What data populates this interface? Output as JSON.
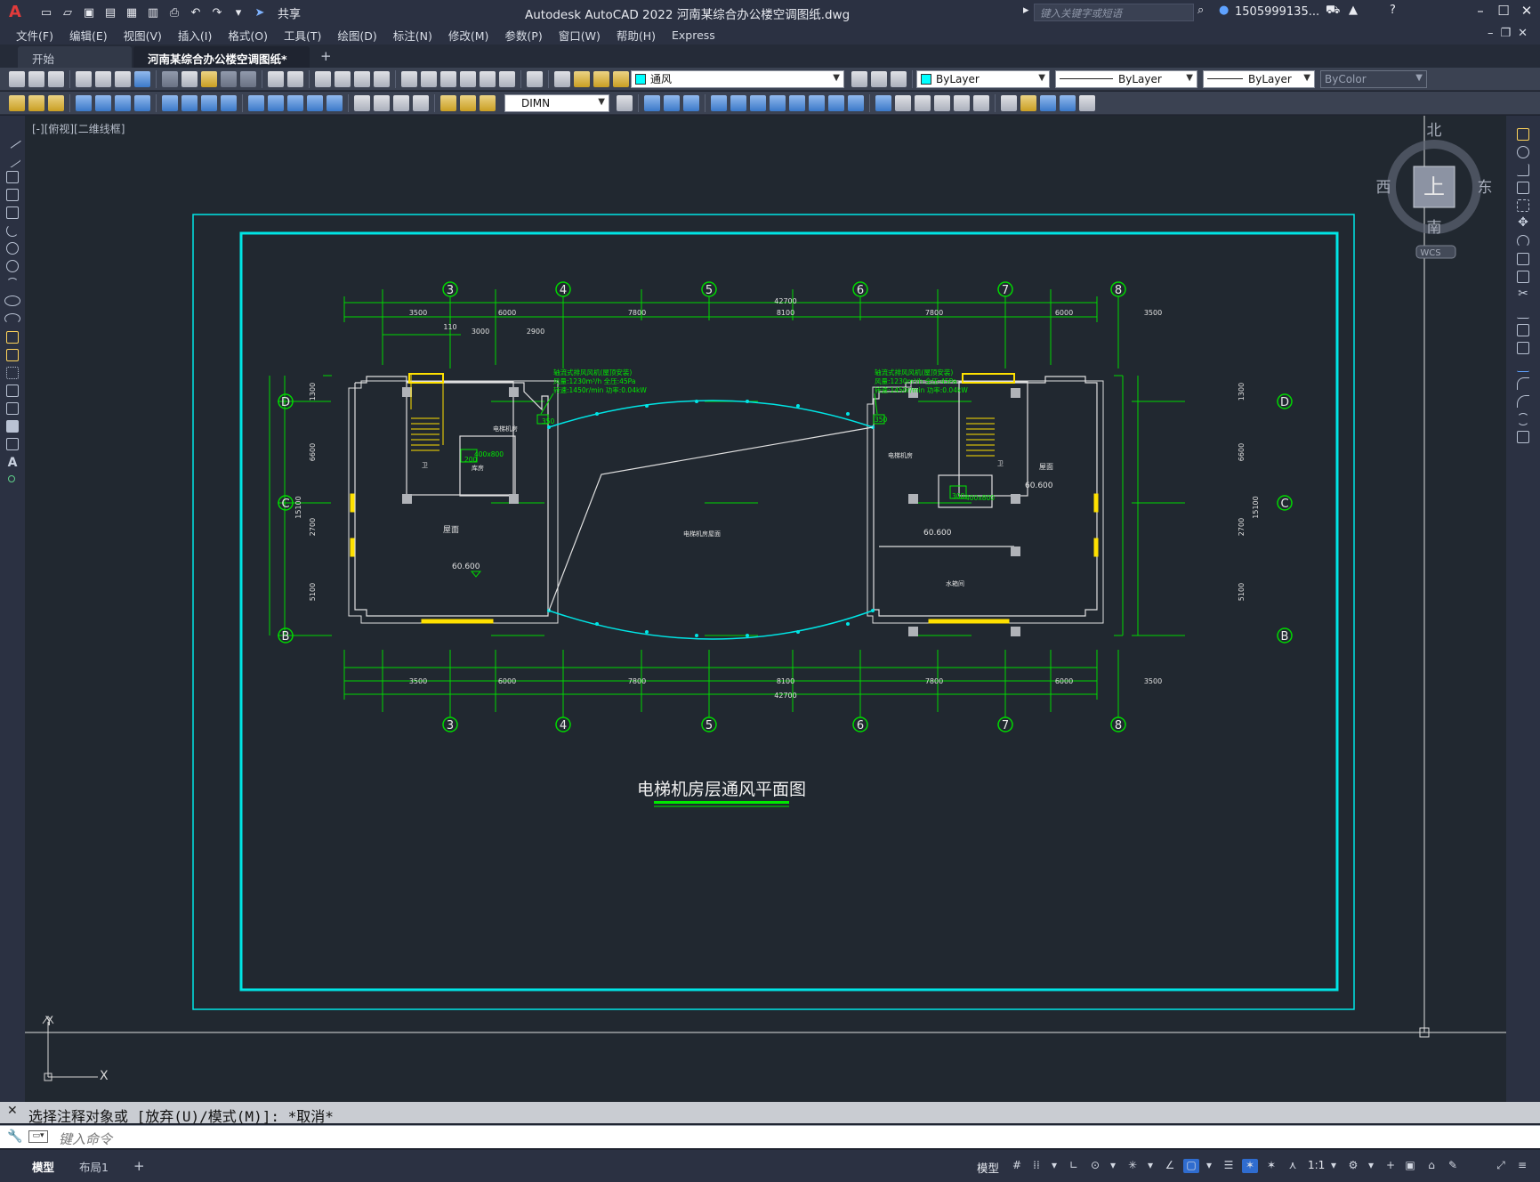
{
  "titlebar": {
    "share_label": "共享",
    "window_title": "Autodesk AutoCAD 2022    河南某综合办公楼空调图纸.dwg",
    "search_placeholder": "键入关键字或短语",
    "user": "1505999135...",
    "icons": [
      "autocad-logo-icon",
      "new-icon",
      "open-icon",
      "save-icon",
      "saveas-icon",
      "web-open-icon",
      "plot-icon",
      "undo-icon",
      "redo-icon",
      "share-icon",
      "search-icon",
      "user-icon",
      "cart-icon",
      "a360-icon",
      "help-icon",
      "minimize-icon",
      "maximize-icon",
      "close-icon"
    ]
  },
  "menu": {
    "items": [
      "文件(F)",
      "编辑(E)",
      "视图(V)",
      "插入(I)",
      "格式(O)",
      "工具(T)",
      "绘图(D)",
      "标注(N)",
      "修改(M)",
      "参数(P)",
      "窗口(W)",
      "帮助(H)",
      "Express"
    ]
  },
  "tabs": {
    "start": "开始",
    "active": "河南某综合办公楼空调图纸*",
    "close": "✕",
    "add": "+"
  },
  "toolbar1": {
    "layer": "通风",
    "layer_color": "#00ffff",
    "color": "ByLayer",
    "linetype": "ByLayer",
    "lineweight": "ByLayer",
    "plotstyle": "ByColor"
  },
  "toolbar2": {
    "dimstyle": "DIMN"
  },
  "viewport": {
    "label": "[-][俯视][二维线框]"
  },
  "viewcube": {
    "north": "北",
    "south": "南",
    "east": "东",
    "west": "西",
    "top": "上",
    "wcs": "WCS"
  },
  "drawing": {
    "title": "电梯机房层通风平面图",
    "grid_top": [
      "3",
      "4",
      "5",
      "6",
      "7",
      "8"
    ],
    "grid_side": [
      "D",
      "C",
      "B"
    ],
    "total_dim": "42700",
    "dims": [
      "3500",
      "6000",
      "7800",
      "8100",
      "7800",
      "6000",
      "3500"
    ],
    "sub_dims": [
      "110",
      "3000",
      "2900"
    ],
    "side_dims": [
      "1300",
      "6600",
      "2700",
      "5100"
    ],
    "side_total": "15100",
    "fan_note_1": "轴流式排风风机(屋顶安装)",
    "fan_note_2": "风量:1230m³/h 全压:45Pa",
    "fan_note_3": "转速:1450r/min 功率:0.04kW",
    "elevations": [
      "60.600",
      "60.600",
      "60.600"
    ],
    "room_center": "电梯机房屋面",
    "room_left": "屋面",
    "room_right": "屋面",
    "room_mid_right": "水箱间",
    "room_elec_left": "电梯机房",
    "room_elec_right": "电梯机房",
    "room_store": "库房",
    "room_toilet": "卫",
    "duct_size_left": "400x800",
    "duct_size_right": "400x800",
    "duct_small": "350",
    "duct_small2": "200",
    "duct_small3": "300"
  },
  "command": {
    "history": "选择注释对象或 [放弃(U)/模式(M)]: *取消*",
    "input_placeholder": "键入命令"
  },
  "status": {
    "layout_tabs": [
      "模型",
      "布局1"
    ],
    "add": "+",
    "model": "模型",
    "scale": "1:1"
  }
}
